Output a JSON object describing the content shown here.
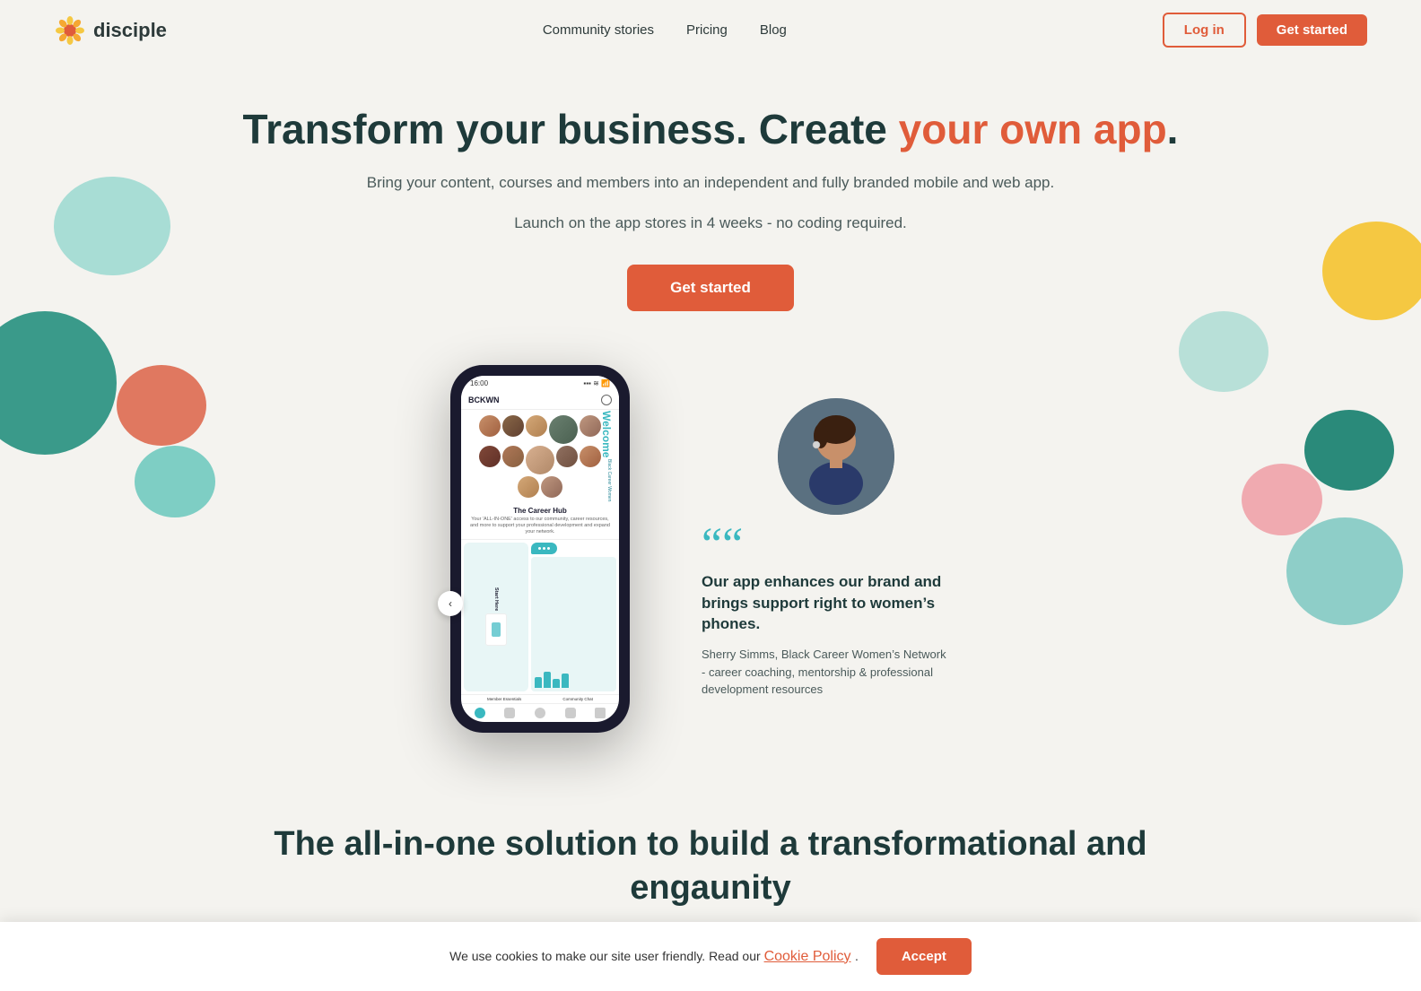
{
  "nav": {
    "logo_text": "disciple",
    "links": [
      {
        "label": "Community stories",
        "href": "#"
      },
      {
        "label": "Pricing",
        "href": "#"
      },
      {
        "label": "Blog",
        "href": "#"
      }
    ],
    "login_label": "Log in",
    "get_started_label": "Get started"
  },
  "hero": {
    "heading_part1": "Transform your business. Create ",
    "heading_accent": "your own app",
    "heading_end": ".",
    "subtext_line1": "Bring your content, courses and members into an independent and fully branded mobile and web app.",
    "subtext_line2": "Launch on the app stores in 4 weeks - no coding required.",
    "cta_label": "Get started"
  },
  "phone": {
    "time": "16:00",
    "brand": "BCKWN",
    "welcome_text": "Welcome",
    "welcome_subtitle": "Black Career Women",
    "career_hub_title": "The Career Hub",
    "career_hub_desc": "Your 'ALL-IN-ONE' access to our community, career resources, and more to support your professional development and expand your network.",
    "start_here_label": "Start Here",
    "member_essentials_label": "Member Essentials",
    "community_chat_label": "Community Chat"
  },
  "testimonial": {
    "quote_marks": "““",
    "text": "Our app enhances our brand and brings support right to women’s phones.",
    "author_name": "Sherry Simms, Black Career Women’s Network",
    "author_desc": "- career coaching, mentorship & professional development resources"
  },
  "bottom_section": {
    "heading_line1": "The all-in-one solution to build a transformational and",
    "heading_line2": "enga",
    "heading_end": "unity"
  },
  "cookie_banner": {
    "text": "We use cookies to make our site user friendly. Read our ",
    "link_text": "Cookie Policy",
    "link_suffix": ".",
    "accept_label": "Accept"
  }
}
